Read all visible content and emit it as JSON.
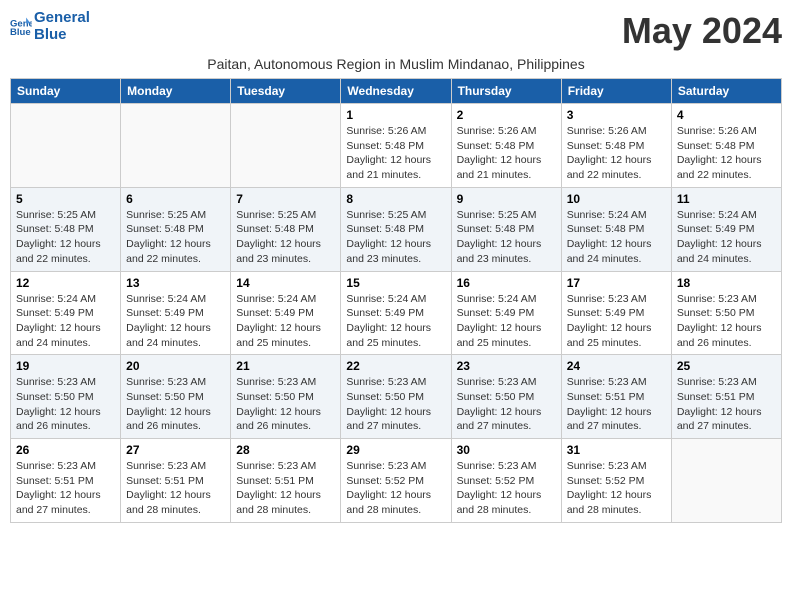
{
  "logo": {
    "line1": "General",
    "line2": "Blue"
  },
  "month": "May 2024",
  "subtitle": "Paitan, Autonomous Region in Muslim Mindanao, Philippines",
  "weekdays": [
    "Sunday",
    "Monday",
    "Tuesday",
    "Wednesday",
    "Thursday",
    "Friday",
    "Saturday"
  ],
  "weeks": [
    [
      {
        "day": "",
        "info": ""
      },
      {
        "day": "",
        "info": ""
      },
      {
        "day": "",
        "info": ""
      },
      {
        "day": "1",
        "info": "Sunrise: 5:26 AM\nSunset: 5:48 PM\nDaylight: 12 hours\nand 21 minutes."
      },
      {
        "day": "2",
        "info": "Sunrise: 5:26 AM\nSunset: 5:48 PM\nDaylight: 12 hours\nand 21 minutes."
      },
      {
        "day": "3",
        "info": "Sunrise: 5:26 AM\nSunset: 5:48 PM\nDaylight: 12 hours\nand 22 minutes."
      },
      {
        "day": "4",
        "info": "Sunrise: 5:26 AM\nSunset: 5:48 PM\nDaylight: 12 hours\nand 22 minutes."
      }
    ],
    [
      {
        "day": "5",
        "info": "Sunrise: 5:25 AM\nSunset: 5:48 PM\nDaylight: 12 hours\nand 22 minutes."
      },
      {
        "day": "6",
        "info": "Sunrise: 5:25 AM\nSunset: 5:48 PM\nDaylight: 12 hours\nand 22 minutes."
      },
      {
        "day": "7",
        "info": "Sunrise: 5:25 AM\nSunset: 5:48 PM\nDaylight: 12 hours\nand 23 minutes."
      },
      {
        "day": "8",
        "info": "Sunrise: 5:25 AM\nSunset: 5:48 PM\nDaylight: 12 hours\nand 23 minutes."
      },
      {
        "day": "9",
        "info": "Sunrise: 5:25 AM\nSunset: 5:48 PM\nDaylight: 12 hours\nand 23 minutes."
      },
      {
        "day": "10",
        "info": "Sunrise: 5:24 AM\nSunset: 5:48 PM\nDaylight: 12 hours\nand 24 minutes."
      },
      {
        "day": "11",
        "info": "Sunrise: 5:24 AM\nSunset: 5:49 PM\nDaylight: 12 hours\nand 24 minutes."
      }
    ],
    [
      {
        "day": "12",
        "info": "Sunrise: 5:24 AM\nSunset: 5:49 PM\nDaylight: 12 hours\nand 24 minutes."
      },
      {
        "day": "13",
        "info": "Sunrise: 5:24 AM\nSunset: 5:49 PM\nDaylight: 12 hours\nand 24 minutes."
      },
      {
        "day": "14",
        "info": "Sunrise: 5:24 AM\nSunset: 5:49 PM\nDaylight: 12 hours\nand 25 minutes."
      },
      {
        "day": "15",
        "info": "Sunrise: 5:24 AM\nSunset: 5:49 PM\nDaylight: 12 hours\nand 25 minutes."
      },
      {
        "day": "16",
        "info": "Sunrise: 5:24 AM\nSunset: 5:49 PM\nDaylight: 12 hours\nand 25 minutes."
      },
      {
        "day": "17",
        "info": "Sunrise: 5:23 AM\nSunset: 5:49 PM\nDaylight: 12 hours\nand 25 minutes."
      },
      {
        "day": "18",
        "info": "Sunrise: 5:23 AM\nSunset: 5:50 PM\nDaylight: 12 hours\nand 26 minutes."
      }
    ],
    [
      {
        "day": "19",
        "info": "Sunrise: 5:23 AM\nSunset: 5:50 PM\nDaylight: 12 hours\nand 26 minutes."
      },
      {
        "day": "20",
        "info": "Sunrise: 5:23 AM\nSunset: 5:50 PM\nDaylight: 12 hours\nand 26 minutes."
      },
      {
        "day": "21",
        "info": "Sunrise: 5:23 AM\nSunset: 5:50 PM\nDaylight: 12 hours\nand 26 minutes."
      },
      {
        "day": "22",
        "info": "Sunrise: 5:23 AM\nSunset: 5:50 PM\nDaylight: 12 hours\nand 27 minutes."
      },
      {
        "day": "23",
        "info": "Sunrise: 5:23 AM\nSunset: 5:50 PM\nDaylight: 12 hours\nand 27 minutes."
      },
      {
        "day": "24",
        "info": "Sunrise: 5:23 AM\nSunset: 5:51 PM\nDaylight: 12 hours\nand 27 minutes."
      },
      {
        "day": "25",
        "info": "Sunrise: 5:23 AM\nSunset: 5:51 PM\nDaylight: 12 hours\nand 27 minutes."
      }
    ],
    [
      {
        "day": "26",
        "info": "Sunrise: 5:23 AM\nSunset: 5:51 PM\nDaylight: 12 hours\nand 27 minutes."
      },
      {
        "day": "27",
        "info": "Sunrise: 5:23 AM\nSunset: 5:51 PM\nDaylight: 12 hours\nand 28 minutes."
      },
      {
        "day": "28",
        "info": "Sunrise: 5:23 AM\nSunset: 5:51 PM\nDaylight: 12 hours\nand 28 minutes."
      },
      {
        "day": "29",
        "info": "Sunrise: 5:23 AM\nSunset: 5:52 PM\nDaylight: 12 hours\nand 28 minutes."
      },
      {
        "day": "30",
        "info": "Sunrise: 5:23 AM\nSunset: 5:52 PM\nDaylight: 12 hours\nand 28 minutes."
      },
      {
        "day": "31",
        "info": "Sunrise: 5:23 AM\nSunset: 5:52 PM\nDaylight: 12 hours\nand 28 minutes."
      },
      {
        "day": "",
        "info": ""
      }
    ]
  ]
}
